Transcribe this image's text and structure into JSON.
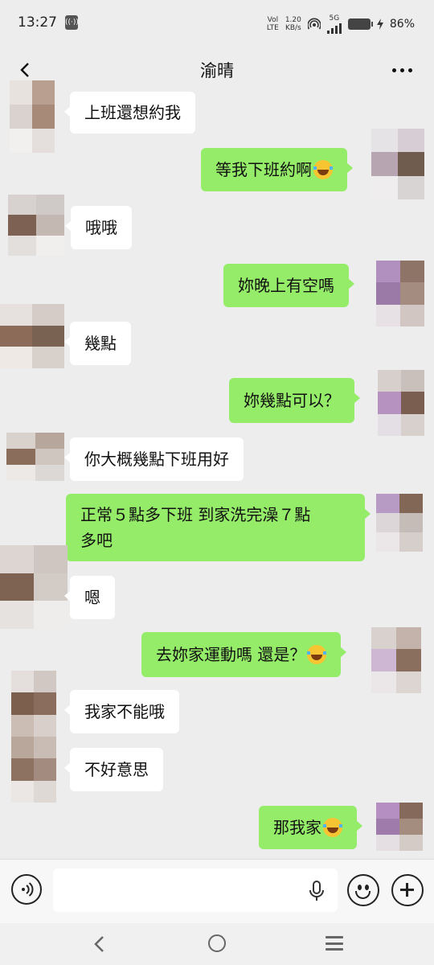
{
  "status_bar": {
    "time": "13:27",
    "network_top": "Vol",
    "network_bottom": "LTE",
    "speed_top": "1.20",
    "speed_bottom": "KB/s",
    "signal_label": "5G",
    "battery": "86%"
  },
  "header": {
    "title": "渝晴"
  },
  "messages": [
    {
      "side": "in",
      "text": "上班還想約我",
      "emoji": false
    },
    {
      "side": "out",
      "text": "等我下班約啊",
      "emoji": true
    },
    {
      "side": "in",
      "text": "哦哦",
      "emoji": false
    },
    {
      "side": "out",
      "text": "妳晚上有空嗎",
      "emoji": false
    },
    {
      "side": "in",
      "text": "幾點",
      "emoji": false
    },
    {
      "side": "out",
      "text": "妳幾點可以？",
      "emoji": false
    },
    {
      "side": "in",
      "text": "你大概幾點下班用好",
      "emoji": false
    },
    {
      "side": "out",
      "text_line1": "正常５點多下班 到家洗完澡７點",
      "text_line2": "多吧",
      "emoji": false
    },
    {
      "side": "in",
      "text": "嗯",
      "emoji": false
    },
    {
      "side": "out",
      "text": "去妳家運動嗎 還是？",
      "emoji": true
    },
    {
      "side": "in",
      "text": "我家不能哦",
      "emoji": false
    },
    {
      "side": "in",
      "text": "不好意思",
      "emoji": false
    },
    {
      "side": "out",
      "text": "那我家",
      "emoji": true
    }
  ],
  "input_bar": {
    "placeholder": "",
    "icons": [
      "voice-icon",
      "microphone-icon",
      "emoji-face-icon",
      "plus-icon"
    ]
  },
  "nav_bar": {
    "icons": [
      "nav-back-icon",
      "nav-home-icon",
      "nav-menu-icon"
    ]
  },
  "colors": {
    "background": "#ededed",
    "outgoing_bubble": "#95ec69",
    "incoming_bubble": "#ffffff"
  }
}
